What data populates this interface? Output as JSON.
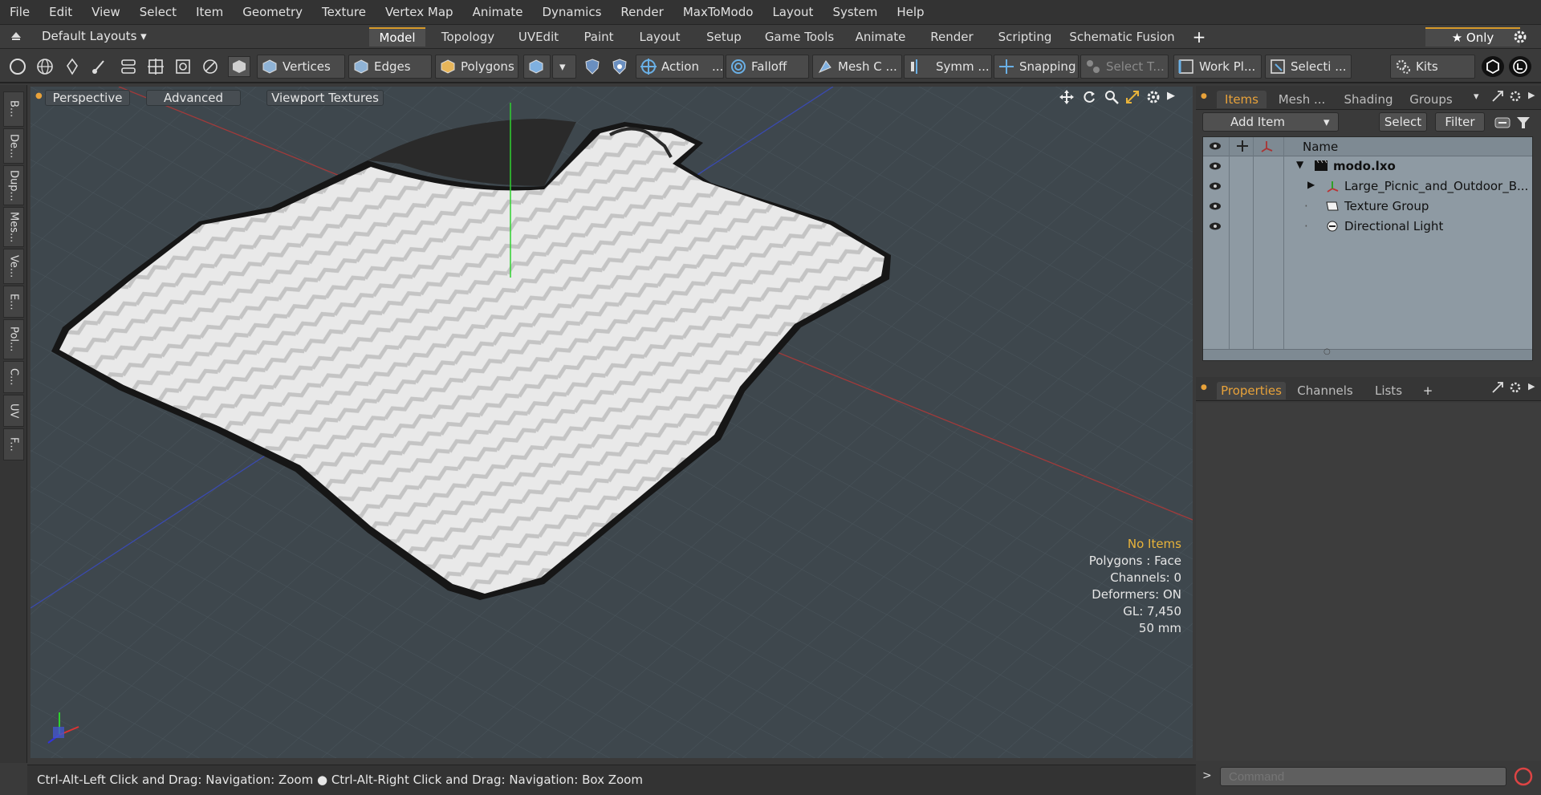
{
  "menu": [
    "File",
    "Edit",
    "View",
    "Select",
    "Item",
    "Geometry",
    "Texture",
    "Vertex Map",
    "Animate",
    "Dynamics",
    "Render",
    "MaxToModo",
    "Layout",
    "System",
    "Help"
  ],
  "layouts": {
    "label": "Default Layouts ▾"
  },
  "tabs": [
    "Model",
    "Topology",
    "UVEdit",
    "Paint",
    "Layout",
    "Setup",
    "Game Tools",
    "Animate",
    "Render",
    "Scripting",
    "Schematic Fusion"
  ],
  "tabs_plus": "+",
  "only_label": "★  Only",
  "toolbar": {
    "vertices": "Vertices",
    "edges": "Edges",
    "polygons": "Polygons",
    "action": "Action",
    "action_more": "...",
    "falloff": "Falloff",
    "mesh": "Mesh C ...",
    "symm": "Symm ...",
    "snapping": "Snapping",
    "select_t": "Select T...",
    "workplane": "Work Pl...",
    "selecti": "Selecti ...",
    "kits": "Kits"
  },
  "left_tabs": [
    "B...",
    "De...",
    "Dup...",
    "Mes...",
    "Ve...",
    "E...",
    "Pol...",
    "C...",
    "UV",
    "F..."
  ],
  "viewport": {
    "perspective": "Perspective",
    "advanced": "Advanced",
    "viewport_textures": "Viewport Textures",
    "info": {
      "no_items": "No Items",
      "polygons": "Polygons : Face",
      "channels": "Channels: 0",
      "deformers": "Deformers: ON",
      "gl": "GL: 7,450",
      "units": "50 mm"
    }
  },
  "status": "Ctrl-Alt-Left Click and Drag: Navigation: Zoom ● Ctrl-Alt-Right Click and Drag: Navigation: Box Zoom",
  "items_panel": {
    "tabs": [
      "Items",
      "Mesh ...",
      "Shading",
      "Groups"
    ],
    "add_item": "Add Item",
    "select": "Select",
    "filter": "Filter",
    "col_name": "Name",
    "rows": [
      {
        "name": "modo.lxo"
      },
      {
        "name": "Large_Picnic_and_Outdoor_B..."
      },
      {
        "name": "Texture Group"
      },
      {
        "name": "Directional Light"
      }
    ]
  },
  "props_panel": {
    "tabs": [
      "Properties",
      "Channels",
      "Lists"
    ],
    "plus": "+"
  },
  "command": {
    "placeholder": "Command"
  },
  "colors": {
    "accent": "#e8a23a",
    "viewport_bg": "#3e474d",
    "tree_bg": "#8e9aa3"
  }
}
